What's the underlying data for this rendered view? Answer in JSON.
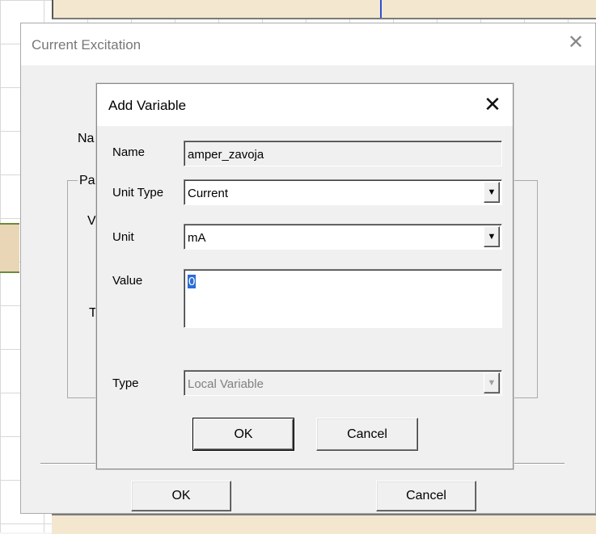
{
  "background_dialog": {
    "title": "Current Excitation",
    "close_glyph": "✕",
    "fragments": {
      "name_frag": "Na",
      "params_frag": "Pa",
      "v_frag": "V",
      "t_frag": "T"
    },
    "ok_label": "OK",
    "cancel_label": "Cancel"
  },
  "add_variable_dialog": {
    "title": "Add Variable",
    "close_glyph": "✕",
    "name_label": "Name",
    "name_value": "amper_zavoja",
    "unit_type_label": "Unit Type",
    "unit_type_value": "Current",
    "unit_label": "Unit",
    "unit_value": "mA",
    "value_label": "Value",
    "value_text": "0",
    "type_label": "Type",
    "type_value": "Local Variable",
    "dropdown_glyph": "▼",
    "ok_label": "OK",
    "cancel_label": "Cancel"
  },
  "colors": {
    "selection": "#2a6dd8",
    "dialog_bg": "#f0f0f0",
    "disabled_text": "#808080"
  }
}
